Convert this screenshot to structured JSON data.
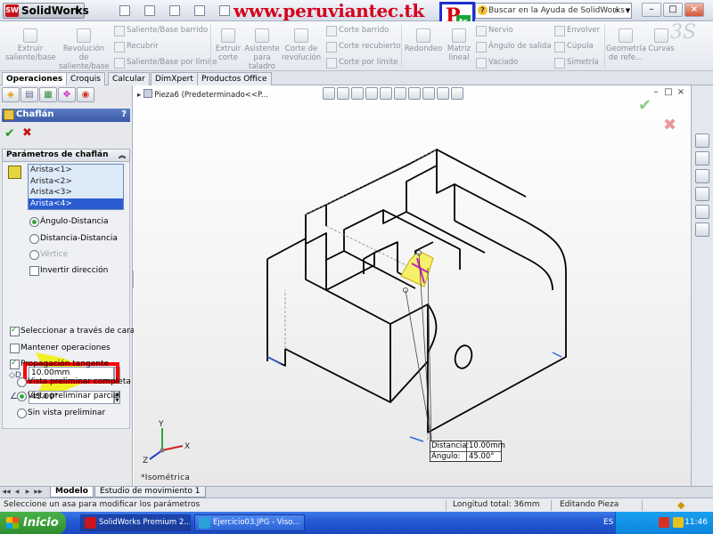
{
  "app": {
    "logo_text": "SolidWorks",
    "watermark": "www.peruviantec.tk",
    "search_placeholder": "Buscar en la Ayuda de SolidWorks",
    "window_buttons": [
      "–",
      "□",
      "×"
    ]
  },
  "ribbon": {
    "large": [
      {
        "label": "Extruir saliente/base",
        "icon": "extrude-boss-icon"
      },
      {
        "label": "Revolución de saliente/base",
        "icon": "revolve-boss-icon"
      },
      {
        "label": "Extruir corte",
        "icon": "extrude-cut-icon"
      },
      {
        "label": "Asistente para taladro",
        "icon": "hole-wizard-icon"
      },
      {
        "label": "Corte de revolución",
        "icon": "revolve-cut-icon"
      },
      {
        "label": "Redondeo",
        "icon": "fillet-icon"
      },
      {
        "label": "Matriz lineal",
        "icon": "linear-pattern-icon"
      },
      {
        "label": "Geometría de refe...",
        "icon": "reference-geometry-icon"
      },
      {
        "label": "Curvas",
        "icon": "curves-icon"
      }
    ],
    "small": [
      "Saliente/Base barrido",
      "Recubrir",
      "Saliente/Base por límite",
      "Corte barrido",
      "Corte recubierto",
      "Corte por límite",
      "Nervio",
      "Ángulo de salida",
      "Vaciado",
      "Envolver",
      "Cúpula",
      "Simetría"
    ]
  },
  "tabs": [
    "Operaciones",
    "Croquis",
    "Calcular",
    "DimXpert",
    "Productos Office"
  ],
  "property_manager": {
    "title": "Chaflán",
    "help": "?",
    "ok": "✔",
    "cancel": "✖",
    "group_title": "Parámetros de chaflán",
    "edges": [
      "Arista<1>",
      "Arista<2>",
      "Arista<3>",
      "Arista<4>"
    ],
    "selected_edge": 3,
    "radios": [
      {
        "label": "Ángulo-Distancia",
        "checked": true,
        "disabled": false
      },
      {
        "label": "Distancia-Distancia",
        "checked": false,
        "disabled": false
      },
      {
        "label": "Vértice",
        "checked": false,
        "disabled": true
      }
    ],
    "flip_direction": {
      "label": "Invertir dirección",
      "checked": false
    },
    "distance_value": "10.00mm",
    "angle_value": "45.00°",
    "options": [
      {
        "label": "Seleccionar a través de caras",
        "checked": true
      },
      {
        "label": "Mantener operaciones",
        "checked": false
      },
      {
        "label": "Propagación tangente",
        "checked": true
      }
    ],
    "preview": [
      {
        "label": "Vista preliminar completa",
        "checked": false
      },
      {
        "label": "Vista preliminar parcial",
        "checked": true
      },
      {
        "label": "Sin vista preliminar",
        "checked": false
      }
    ]
  },
  "viewport": {
    "tree_item": "Pieza6  (Predeterminado<<P...",
    "view_label": "*Isométrica",
    "callout": {
      "distance_label": "Distancia:",
      "distance_value": "10.00mm",
      "angle_label": "Ángulo:",
      "angle_value": "45.00°"
    },
    "triad": {
      "x": "X",
      "y": "Y",
      "z": "Z"
    }
  },
  "bottom_tabs": [
    "Modelo",
    "Estudio de movimiento 1"
  ],
  "status": {
    "message": "Seleccione un asa para modificar los parámetros",
    "length": "Longitud total: 36mm",
    "mode": "Editando Pieza"
  },
  "taskbar": {
    "start": "Inicio",
    "items": [
      "SolidWorks Premium 2...",
      "Ejercicio03.JPG - Viso..."
    ],
    "lang": "ES",
    "clock": "11:46"
  },
  "colors": {
    "accent": "#2a5bd0",
    "highlight_box": "#ff0000",
    "watermark": "#d4001c",
    "ok_green": "#2a9a2a",
    "cancel_red": "#c81818"
  }
}
